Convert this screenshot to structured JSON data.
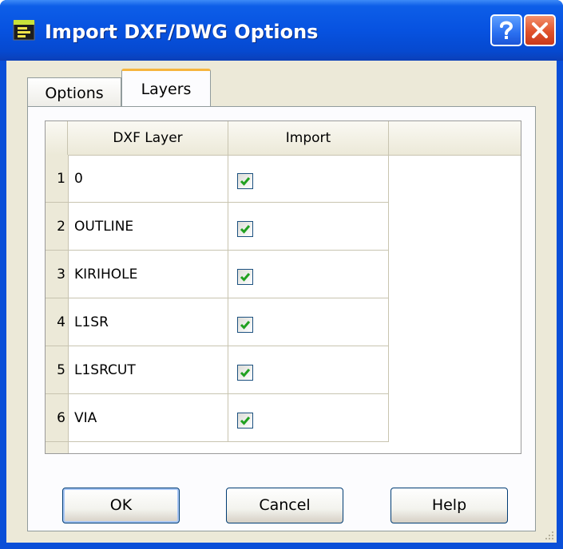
{
  "window": {
    "title": "Import DXF/DWG Options",
    "help_icon": "question-mark-icon",
    "close_icon": "close-x-icon"
  },
  "tabs": [
    {
      "label": "Options",
      "active": false
    },
    {
      "label": "Layers",
      "active": true
    }
  ],
  "grid": {
    "columns": [
      "DXF Layer",
      "Import"
    ],
    "rows": [
      {
        "num": "1",
        "layer": "0",
        "import": true
      },
      {
        "num": "2",
        "layer": "OUTLINE",
        "import": true
      },
      {
        "num": "3",
        "layer": "KIRIHOLE",
        "import": true
      },
      {
        "num": "4",
        "layer": "L1SR",
        "import": true
      },
      {
        "num": "5",
        "layer": "L1SRCUT",
        "import": true
      },
      {
        "num": "6",
        "layer": "VIA",
        "import": true
      }
    ]
  },
  "buttons": {
    "ok": "OK",
    "cancel": "Cancel",
    "help": "Help"
  },
  "colors": {
    "titlebar": "#0752e0",
    "dialog_bg": "#ece9d8",
    "active_tab_accent": "#f6b53d",
    "check": "#21a121"
  }
}
